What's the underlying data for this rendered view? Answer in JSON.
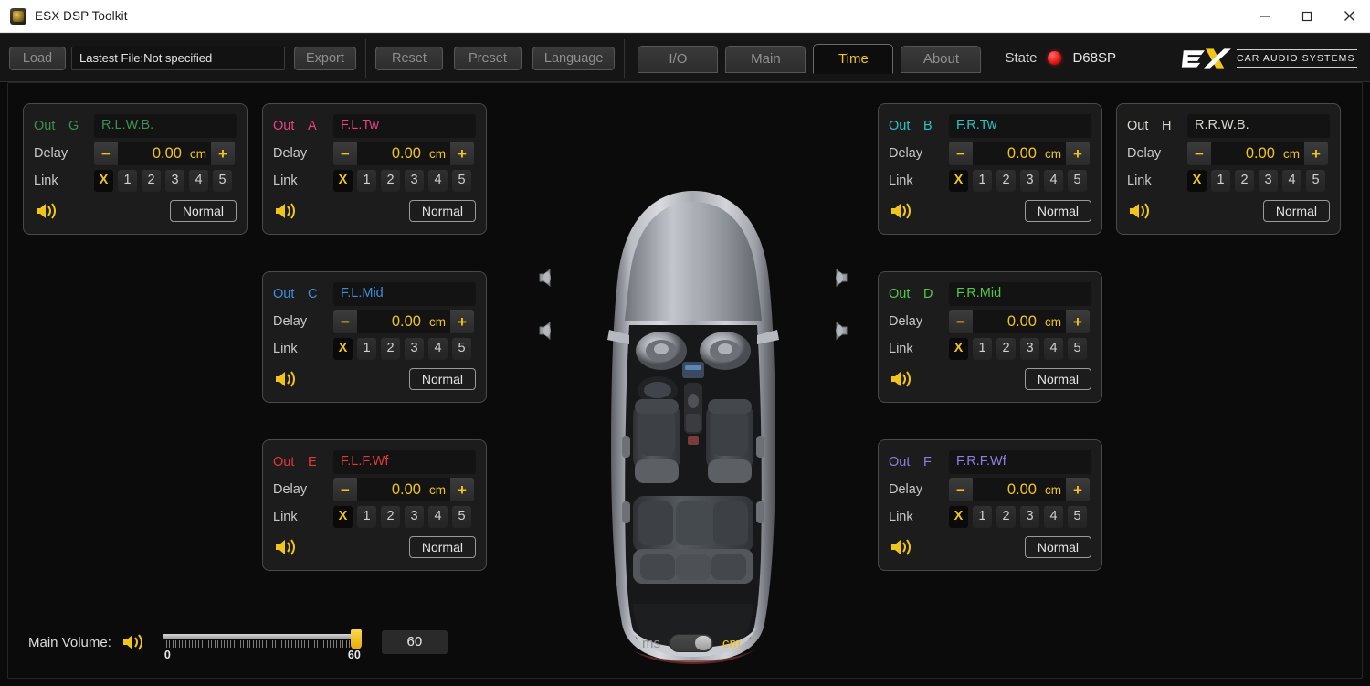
{
  "window": {
    "title": "ESX DSP Toolkit",
    "app_icon": "app-icon",
    "minimize": "minimize-icon",
    "maximize": "maximize-icon",
    "close": "close-icon"
  },
  "toolbar": {
    "load_label": "Load",
    "file_field_value": "Lastest File:Not specified",
    "export_label": "Export",
    "reset_label": "Reset",
    "preset_label": "Preset",
    "language_label": "Language",
    "tabs": [
      {
        "label": "I/O",
        "active": false
      },
      {
        "label": "Main",
        "active": false
      },
      {
        "label": "Time",
        "active": true
      },
      {
        "label": "About",
        "active": false
      }
    ],
    "state_label": "State",
    "state_led_color": "#e01414",
    "device_model": "D68SP",
    "brand_name": "ESX",
    "brand_tagline": "CAR AUDIO SYSTEMS",
    "accent_color": "#f0c419"
  },
  "channels": [
    {
      "id": "g",
      "out_label": "Out",
      "channel": "G",
      "name": "R.L.W.B.",
      "color": "#3f8f52",
      "delay_label": "Delay",
      "minus": "−",
      "delay_value": "0.00",
      "unit": "cm",
      "plus": "+",
      "link_label": "Link",
      "link_options": [
        "X",
        "1",
        "2",
        "3",
        "4",
        "5"
      ],
      "link_selected": "X",
      "mute_icon": "speaker-icon",
      "phase_label": "Normal"
    },
    {
      "id": "a",
      "out_label": "Out",
      "channel": "A",
      "name": "F.L.Tw",
      "color": "#e8417f",
      "delay_label": "Delay",
      "minus": "−",
      "delay_value": "0.00",
      "unit": "cm",
      "plus": "+",
      "link_label": "Link",
      "link_options": [
        "X",
        "1",
        "2",
        "3",
        "4",
        "5"
      ],
      "link_selected": "X",
      "mute_icon": "speaker-icon",
      "phase_label": "Normal"
    },
    {
      "id": "c",
      "out_label": "Out",
      "channel": "C",
      "name": "F.L.Mid",
      "color": "#3d8fdb",
      "delay_label": "Delay",
      "minus": "−",
      "delay_value": "0.00",
      "unit": "cm",
      "plus": "+",
      "link_label": "Link",
      "link_options": [
        "X",
        "1",
        "2",
        "3",
        "4",
        "5"
      ],
      "link_selected": "X",
      "mute_icon": "speaker-icon",
      "phase_label": "Normal"
    },
    {
      "id": "e",
      "out_label": "Out",
      "channel": "E",
      "name": "F.L.F.Wf",
      "color": "#e03a36",
      "delay_label": "Delay",
      "minus": "−",
      "delay_value": "0.00",
      "unit": "cm",
      "plus": "+",
      "link_label": "Link",
      "link_options": [
        "X",
        "1",
        "2",
        "3",
        "4",
        "5"
      ],
      "link_selected": "X",
      "mute_icon": "speaker-icon",
      "phase_label": "Normal"
    },
    {
      "id": "b",
      "out_label": "Out",
      "channel": "B",
      "name": "F.R.Tw",
      "color": "#2fc2c4",
      "delay_label": "Delay",
      "minus": "−",
      "delay_value": "0.00",
      "unit": "cm",
      "plus": "+",
      "link_label": "Link",
      "link_options": [
        "X",
        "1",
        "2",
        "3",
        "4",
        "5"
      ],
      "link_selected": "X",
      "mute_icon": "speaker-icon",
      "phase_label": "Normal"
    },
    {
      "id": "d",
      "out_label": "Out",
      "channel": "D",
      "name": "F.R.Mid",
      "color": "#57c64a",
      "delay_label": "Delay",
      "minus": "−",
      "delay_value": "0.00",
      "unit": "cm",
      "plus": "+",
      "link_label": "Link",
      "link_options": [
        "X",
        "1",
        "2",
        "3",
        "4",
        "5"
      ],
      "link_selected": "X",
      "mute_icon": "speaker-icon",
      "phase_label": "Normal"
    },
    {
      "id": "f",
      "out_label": "Out",
      "channel": "F",
      "name": "F.R.F.Wf",
      "color": "#8e7fe0",
      "delay_label": "Delay",
      "minus": "−",
      "delay_value": "0.00",
      "unit": "cm",
      "plus": "+",
      "link_label": "Link",
      "link_options": [
        "X",
        "1",
        "2",
        "3",
        "4",
        "5"
      ],
      "link_selected": "X",
      "mute_icon": "speaker-icon",
      "phase_label": "Normal"
    },
    {
      "id": "h",
      "out_label": "Out",
      "channel": "H",
      "name": "R.R.W.B.",
      "color": "#d8d8cf",
      "delay_label": "Delay",
      "minus": "−",
      "delay_value": "0.00",
      "unit": "cm",
      "plus": "+",
      "link_label": "Link",
      "link_options": [
        "X",
        "1",
        "2",
        "3",
        "4",
        "5"
      ],
      "link_selected": "X",
      "mute_icon": "speaker-icon",
      "phase_label": "Normal"
    }
  ],
  "car_diagram": {
    "name": "car-top-view",
    "speaker_positions": [
      "front-left",
      "front-right",
      "rear-left",
      "rear-right"
    ]
  },
  "footer": {
    "main_volume_label": "Main Volume:",
    "volume_icon": "speaker-icon",
    "volume_value": "60",
    "slider_min": "0",
    "slider_max": "60",
    "slider_percent": 100,
    "unit_left": "ms",
    "unit_right": "cm",
    "unit_selected": "cm"
  }
}
